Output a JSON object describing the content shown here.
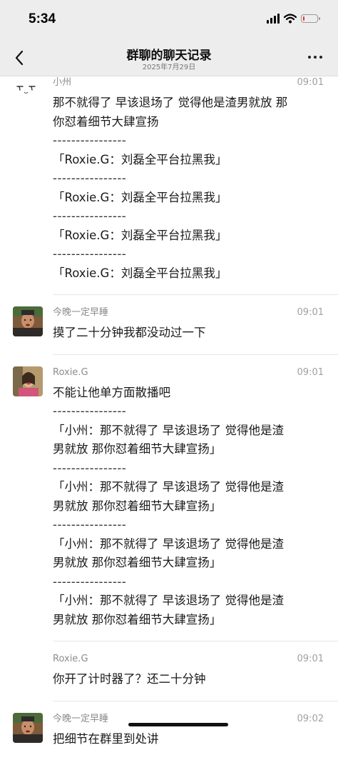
{
  "status_bar": {
    "time": "5:34",
    "battery_level": 0.12,
    "battery_color": "#e33333"
  },
  "header": {
    "title": "群聊的聊天记录",
    "date": "2025年7月29日",
    "back_icon": "chevron-left-icon",
    "more_icon": "ellipsis-icon"
  },
  "messages": [
    {
      "sender": "小州",
      "time": "09:01",
      "lines": [
        "那不就得了 早该退场了 觉得他是渣男就放 那",
        "你怼着细节大肆宣扬",
        "----------------",
        "「Roxie.G：刘磊全平台拉黑我」",
        "----------------",
        "「Roxie.G：刘磊全平台拉黑我」",
        "----------------",
        "「Roxie.G：刘磊全平台拉黑我」",
        "----------------",
        "「Roxie.G：刘磊全平台拉黑我」"
      ]
    },
    {
      "sender": "今晚一定早睡",
      "time": "09:01",
      "lines": [
        "摸了二十分钟我都没动过一下"
      ]
    },
    {
      "sender": "Roxie.G",
      "time": "09:01",
      "lines": [
        "不能让他单方面散播吧",
        "----------------",
        "「小州：那不就得了 早该退场了 觉得他是渣",
        "男就放 那你怼着细节大肆宣扬」",
        "----------------",
        "「小州：那不就得了 早该退场了 觉得他是渣",
        "男就放 那你怼着细节大肆宣扬」",
        "----------------",
        "「小州：那不就得了 早该退场了 觉得他是渣",
        "男就放 那你怼着细节大肆宣扬」",
        "----------------",
        "「小州：那不就得了 早该退场了 觉得他是渣",
        "男就放 那你怼着细节大肆宣扬」"
      ]
    },
    {
      "sender": "Roxie.G",
      "time": "09:01",
      "lines": [
        "你开了计时器了？还二十分钟"
      ]
    },
    {
      "sender": "今晚一定早睡",
      "time": "09:02",
      "lines": [
        "把细节在群里到处讲"
      ]
    }
  ]
}
